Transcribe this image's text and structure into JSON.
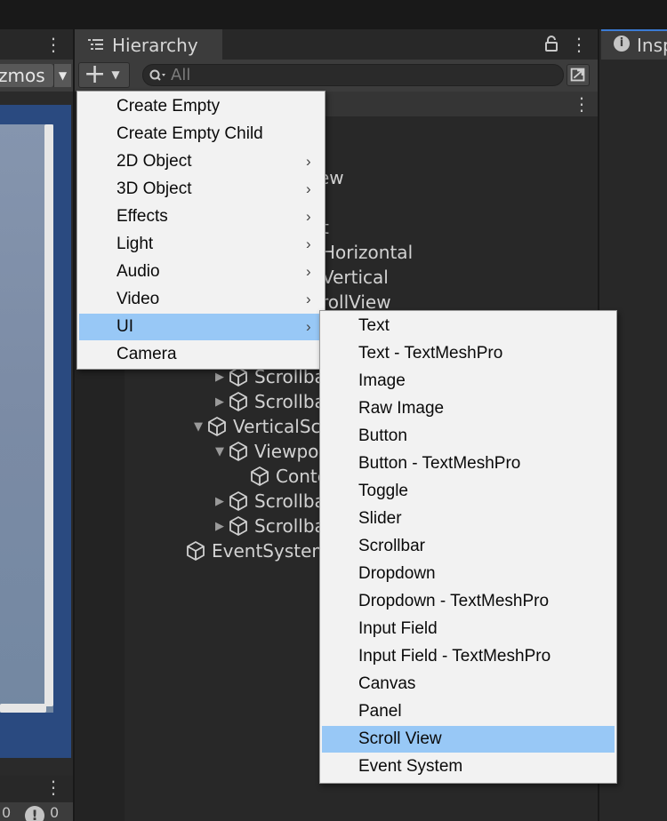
{
  "scene": {
    "gizmos_label": "zmos",
    "console_count_a": "0",
    "console_count_b": "0"
  },
  "hierarchy": {
    "tab_title": "Hierarchy",
    "search_placeholder": "All",
    "rows": [
      {
        "label": "ew",
        "indent": 0,
        "fold": "",
        "cube": false
      },
      {
        "label": "t",
        "indent": 0,
        "fold": "",
        "cube": false
      },
      {
        "label": "Horizontal",
        "indent": 0,
        "fold": "",
        "cube": false
      },
      {
        "label": "Vertical",
        "indent": 0,
        "fold": "",
        "cube": false
      },
      {
        "label": "crollView",
        "indent": 0,
        "fold": "",
        "cube": false
      },
      {
        "label": "Scrollbar",
        "indent": 2,
        "fold": "closed",
        "cube": true
      },
      {
        "label": "Scrollbar",
        "indent": 2,
        "fold": "closed",
        "cube": true
      },
      {
        "label": "VerticalScro",
        "indent": 1,
        "fold": "open",
        "cube": true
      },
      {
        "label": "Viewport",
        "indent": 2,
        "fold": "open",
        "cube": true
      },
      {
        "label": "Conter",
        "indent": 3,
        "fold": "",
        "cube": true
      },
      {
        "label": "Scrollbar",
        "indent": 2,
        "fold": "closed",
        "cube": true
      },
      {
        "label": "Scrollbar",
        "indent": 2,
        "fold": "closed",
        "cube": true
      },
      {
        "label": "EventSystem",
        "indent": 0,
        "fold": "",
        "cube": true
      }
    ]
  },
  "inspector": {
    "tab_title": "Insp"
  },
  "create_menu": {
    "items": [
      {
        "label": "Create Empty",
        "has_submenu": false,
        "selected": false
      },
      {
        "label": "Create Empty Child",
        "has_submenu": false,
        "selected": false
      },
      {
        "label": "2D Object",
        "has_submenu": true,
        "selected": false
      },
      {
        "label": "3D Object",
        "has_submenu": true,
        "selected": false
      },
      {
        "label": "Effects",
        "has_submenu": true,
        "selected": false
      },
      {
        "label": "Light",
        "has_submenu": true,
        "selected": false
      },
      {
        "label": "Audio",
        "has_submenu": true,
        "selected": false
      },
      {
        "label": "Video",
        "has_submenu": true,
        "selected": false
      },
      {
        "label": "UI",
        "has_submenu": true,
        "selected": true
      },
      {
        "label": "Camera",
        "has_submenu": false,
        "selected": false
      }
    ]
  },
  "ui_submenu": {
    "items": [
      {
        "label": "Text",
        "selected": false
      },
      {
        "label": "Text - TextMeshPro",
        "selected": false
      },
      {
        "label": "Image",
        "selected": false
      },
      {
        "label": "Raw Image",
        "selected": false
      },
      {
        "label": "Button",
        "selected": false
      },
      {
        "label": "Button - TextMeshPro",
        "selected": false
      },
      {
        "label": "Toggle",
        "selected": false
      },
      {
        "label": "Slider",
        "selected": false
      },
      {
        "label": "Scrollbar",
        "selected": false
      },
      {
        "label": "Dropdown",
        "selected": false
      },
      {
        "label": "Dropdown - TextMeshPro",
        "selected": false
      },
      {
        "label": "Input Field",
        "selected": false
      },
      {
        "label": "Input Field - TextMeshPro",
        "selected": false
      },
      {
        "label": "Canvas",
        "selected": false
      },
      {
        "label": "Panel",
        "selected": false
      },
      {
        "label": "Scroll View",
        "selected": true
      },
      {
        "label": "Event System",
        "selected": false
      }
    ]
  },
  "colors": {
    "menu_background": "#f2f2f2",
    "menu_highlight": "#98c8f6",
    "panel_dark": "#282828",
    "toolbar": "#3c3c3c",
    "scene_frame": "#2a4a80"
  }
}
